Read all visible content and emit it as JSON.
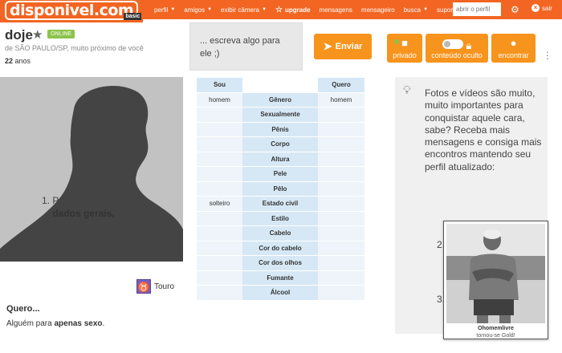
{
  "brand": {
    "name": "disponivel.com",
    "tier": "basic"
  },
  "nav": {
    "items": [
      {
        "label": "perfil",
        "caret": true
      },
      {
        "label": "amigos",
        "caret": true
      },
      {
        "label": "exibir câmera",
        "caret": true
      },
      {
        "label": "upgrade",
        "icon": "star-outline-icon"
      },
      {
        "label": "mensagens"
      },
      {
        "label": "mensageiro"
      },
      {
        "label": "busca",
        "caret": true
      },
      {
        "label": "suporte"
      }
    ],
    "search_placeholder": "abrir o perfil",
    "exit_label": "sair"
  },
  "profile": {
    "name": "doje",
    "status": "ONLINE",
    "location": "de SÃO PAULO/SP, muito próximo de você",
    "age_number": "22",
    "age_unit": "anos",
    "sign": "Touro",
    "wants_heading": "Quero...",
    "wants_text_prefix": "Alguém para ",
    "wants_text_bold": "apenas sexo",
    "wants_text_suffix": "."
  },
  "message": {
    "placeholder": "... escreva algo para ele ;)",
    "send_label": "Enviar"
  },
  "actions": {
    "privado": "privado",
    "oculto": "conteúdo oculto",
    "encontrar": "encontrar"
  },
  "table": {
    "header_left": "Sou",
    "header_right": "Quero",
    "rows": [
      {
        "left": "homem",
        "label": "Gênero",
        "right": "homem"
      },
      {
        "left": "",
        "label": "Sexualmente",
        "right": ""
      },
      {
        "left": "",
        "label": "Pênis",
        "right": ""
      },
      {
        "left": "",
        "label": "Corpo",
        "right": ""
      },
      {
        "left": "",
        "label": "Altura",
        "right": ""
      },
      {
        "left": "",
        "label": "Pele",
        "right": ""
      },
      {
        "left": "",
        "label": "Pêlo",
        "right": ""
      },
      {
        "left": "solteiro",
        "label": "Estado civil",
        "right": ""
      },
      {
        "left": "",
        "label": "Estilo",
        "right": ""
      },
      {
        "left": "",
        "label": "Cabelo",
        "right": ""
      },
      {
        "left": "",
        "label": "Cor do cabelo",
        "right": ""
      },
      {
        "left": "",
        "label": "Cor dos olhos",
        "right": ""
      },
      {
        "left": "",
        "label": "Fumante",
        "right": ""
      },
      {
        "left": "",
        "label": "Álcool",
        "right": ""
      }
    ]
  },
  "tip": {
    "text": "Fotos e vídeos são muito, muito importantes para conquistar aquele cara, sabe? Receba mais mensagens e consiga mais encontros mantendo seu perfil atualizado:",
    "item1_prefix": "Preencha seus",
    "item1_bold": "dados gerais,",
    "num2": "2.",
    "num3": "3."
  },
  "gold_card": {
    "name": "Ohomemlivre",
    "subtitle": "tornou-se Gold!"
  },
  "colors": {
    "brand_orange": "#f26522",
    "button_orange": "#f7941d",
    "online_green": "#8bc34a",
    "table_header_blue": "#d6e8f5",
    "table_light_blue": "#eef4fa"
  }
}
